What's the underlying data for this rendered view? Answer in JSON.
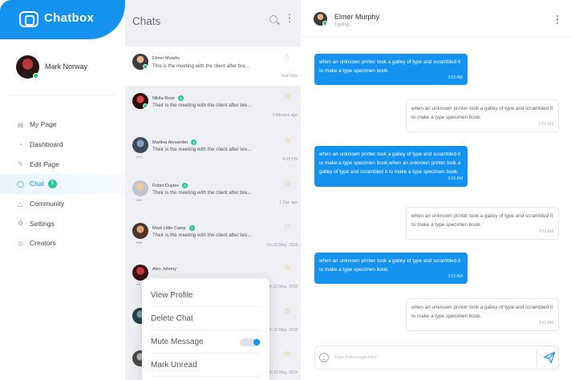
{
  "brand": {
    "name": "Chatbox"
  },
  "profile": {
    "name": "Mark Norway"
  },
  "nav": {
    "items": [
      {
        "label": "My Page",
        "icon": "document-icon"
      },
      {
        "label": "Dashboard",
        "icon": "gauge-icon"
      },
      {
        "label": "Edit Page",
        "icon": "edit-icon"
      },
      {
        "label": "Chat",
        "icon": "chat-icon",
        "badge": "5",
        "active": true
      },
      {
        "label": "Community",
        "icon": "community-icon"
      },
      {
        "label": "Settings",
        "icon": "gear-icon"
      },
      {
        "label": "Creators",
        "icon": "globe-icon"
      }
    ]
  },
  "chats": {
    "title": "Chats",
    "items": [
      {
        "name": "Elmer Murphy",
        "message": "This is the meeting with the client after bre...",
        "time": "Just Now",
        "badge": "",
        "starred": false,
        "selected": true
      },
      {
        "name": "Nikita Rose",
        "message": "Their is the meeting with the client after bre...",
        "time": "5 Minutes ago",
        "badge": "2",
        "starred": true
      },
      {
        "name": "Martina Alexander",
        "message": "Their is the meeting with the client after bre...",
        "time": "4:28 PM",
        "badge": "1",
        "starred": true
      },
      {
        "name": "Robin Duplex",
        "message": "Their is the meeting with the client after bre...",
        "time": "1 Day ago",
        "badge": "1",
        "starred": true
      },
      {
        "name": "Mark Little Camp",
        "message": "Their is the meeting with the client after bre...",
        "time": "On 22 May, 2018",
        "badge": "1",
        "starred": false
      },
      {
        "name": "Alex Johnny",
        "message": "",
        "time": "On 22 May, 2018",
        "badge": "",
        "starred": true
      },
      {
        "name": "",
        "message": "",
        "time": "On 22 May, 2018",
        "badge": "",
        "starred": true
      },
      {
        "name": "",
        "message": "",
        "time": "On 22 May, 2018",
        "badge": "",
        "starred": true
      }
    ]
  },
  "context_menu": {
    "items": [
      "View Profile",
      "Delete Chat",
      "Mute Message",
      "Mark Unread"
    ],
    "mute_enabled": true
  },
  "conversation": {
    "contact_name": "Elmer Murphy",
    "status": "Typing...",
    "messages": [
      {
        "dir": "out",
        "text": "when an unknown printer took a galley of type and scrambled it to make a type specimen book.",
        "time": "3:52 AM"
      },
      {
        "dir": "in",
        "text": "when an unknown printer took a galley of type and scrambled it to make a type specimen book.",
        "time": "3:52 AM"
      },
      {
        "dir": "out",
        "text": "when an unknown printer took a galley of type and scrambled it to make a type specimen book.when an unknown printer took a galley of type and scrambled it to make a type specimen book.",
        "time": "3:52 AM"
      },
      {
        "dir": "in",
        "text": "when an unknown printer took a galley of type and scrambled it to make a type specimen book.",
        "time": "3:52 AM"
      },
      {
        "dir": "out",
        "text": "when an unknown printer took a galley of type and scrambled it to make a type specimen book.",
        "time": "3:52 AM"
      },
      {
        "dir": "in",
        "text": "when an unknown printer took a galley of type and scrambled it to make a type specimen book.",
        "time": "3:52 AM"
      }
    ],
    "composer_placeholder": "Type a message here"
  },
  "colors": {
    "accent": "#1492f0",
    "badge": "#2ac4a0",
    "online": "#27c46a",
    "star": "#f2b234"
  }
}
